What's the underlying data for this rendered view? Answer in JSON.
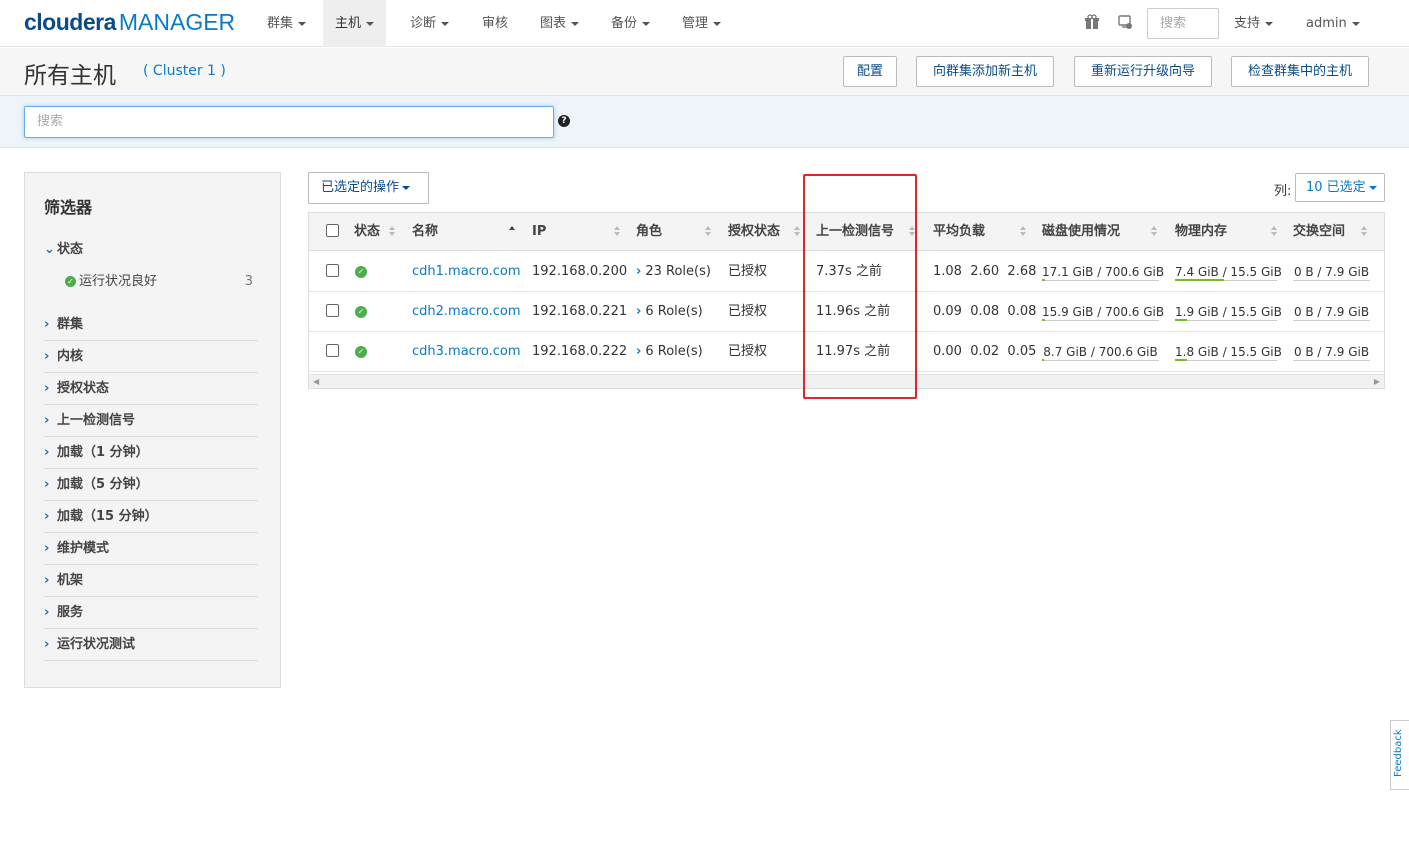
{
  "app": {
    "logo_main": "cloudera",
    "logo_sub": "MANAGER"
  },
  "nav": {
    "items": [
      {
        "label": "群集",
        "dropdown": true
      },
      {
        "label": "主机",
        "dropdown": true,
        "active": true
      },
      {
        "label": "诊断",
        "dropdown": true
      },
      {
        "label": "审核",
        "dropdown": false
      },
      {
        "label": "图表",
        "dropdown": true
      },
      {
        "label": "备份",
        "dropdown": true
      },
      {
        "label": "管理",
        "dropdown": true
      }
    ],
    "icons": [
      "gift-icon",
      "notification-icon"
    ],
    "search_placeholder": "搜索",
    "support_label": "支持",
    "user_label": "admin"
  },
  "title": {
    "page_title": "所有主机",
    "cluster": "( Cluster 1 )",
    "buttons": [
      "配置",
      "向群集添加新主机",
      "重新运行升级向导",
      "检查群集中的主机"
    ]
  },
  "search": {
    "placeholder": "搜索",
    "help_icon": "question-icon"
  },
  "filters": {
    "title": "筛选器",
    "status_section": "状态",
    "status_item": "运行状况良好",
    "status_count": "3",
    "sections": [
      "群集",
      "内核",
      "授权状态",
      "上一检测信号",
      "加载（1 分钟）",
      "加载（5 分钟）",
      "加载（15 分钟）",
      "维护模式",
      "机架",
      "服务",
      "运行状况测试"
    ]
  },
  "toolbar": {
    "actions_label": "已选定的操作",
    "columns_label": "列:",
    "columns_selected": "10 已选定"
  },
  "table": {
    "headers": [
      "状态",
      "名称",
      "IP",
      "角色",
      "授权状态",
      "上一检测信号",
      "平均负载",
      "磁盘使用情况",
      "物理内存",
      "交换空间"
    ],
    "rows": [
      {
        "name": "cdh1.macro.com",
        "ip": "192.168.0.200",
        "roles": "23 Role(s)",
        "auth": "已授权",
        "heartbeat": "7.37s 之前",
        "load": "1.08  2.60  2.68",
        "disk": "17.1 GiB / 700.6 GiB",
        "disk_frac": 0.024,
        "mem": "7.4 GiB / 15.5 GiB",
        "mem_frac": 0.48,
        "swap": "0 B / 7.9 GiB",
        "swap_frac": 0
      },
      {
        "name": "cdh2.macro.com",
        "ip": "192.168.0.221",
        "roles": "6 Role(s)",
        "auth": "已授权",
        "heartbeat": "11.96s 之前",
        "load": "0.09  0.08  0.08",
        "disk": "15.9 GiB / 700.6 GiB",
        "disk_frac": 0.023,
        "mem": "1.9 GiB / 15.5 GiB",
        "mem_frac": 0.12,
        "swap": "0 B / 7.9 GiB",
        "swap_frac": 0
      },
      {
        "name": "cdh3.macro.com",
        "ip": "192.168.0.222",
        "roles": "6 Role(s)",
        "auth": "已授权",
        "heartbeat": "11.97s 之前",
        "load": "0.00  0.02  0.05",
        "disk": "8.7 GiB / 700.6 GiB",
        "disk_frac": 0.012,
        "mem": "1.8 GiB / 15.5 GiB",
        "mem_frac": 0.12,
        "swap": "0 B / 7.9 GiB",
        "swap_frac": 0
      }
    ]
  },
  "feedback": "Feedback",
  "colors": {
    "link": "#0a7ac6",
    "ok": "#4cae4c",
    "bar_fill": "#78b82a",
    "highlight": "#e0262a"
  }
}
